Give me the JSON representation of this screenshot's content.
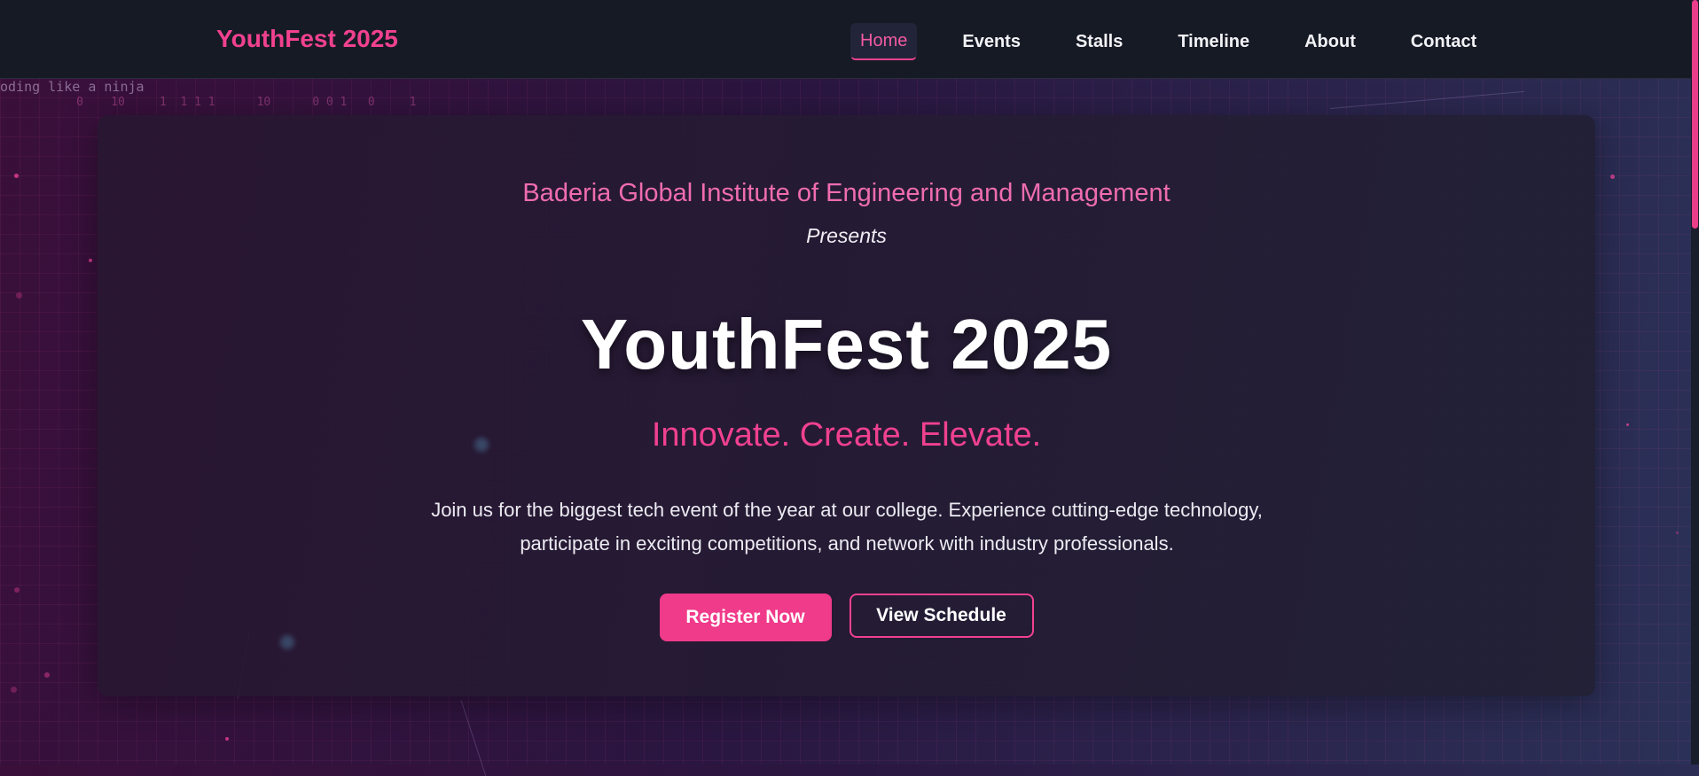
{
  "brand": "YouthFest 2025",
  "nav": {
    "items": [
      {
        "label": "Home",
        "active": true
      },
      {
        "label": "Events"
      },
      {
        "label": "Stalls"
      },
      {
        "label": "Timeline"
      },
      {
        "label": "About"
      },
      {
        "label": "Contact"
      }
    ]
  },
  "background": {
    "code_text": "oding like a ninja"
  },
  "hero": {
    "institute": "Baderia Global Institute of Engineering and Management",
    "presents": "Presents",
    "title": "YouthFest 2025",
    "tagline": "Innovate. Create. Elevate.",
    "description": "Join us for the biggest tech event of the year at our college. Experience cutting-edge technology, participate in exciting competitions, and network with industry professionals.",
    "primary_button": "Register Now",
    "secondary_button": "View Schedule"
  },
  "colors": {
    "accent": "#f0418f",
    "navbar_bg": "#161a25",
    "card_bg": "#241c35"
  }
}
